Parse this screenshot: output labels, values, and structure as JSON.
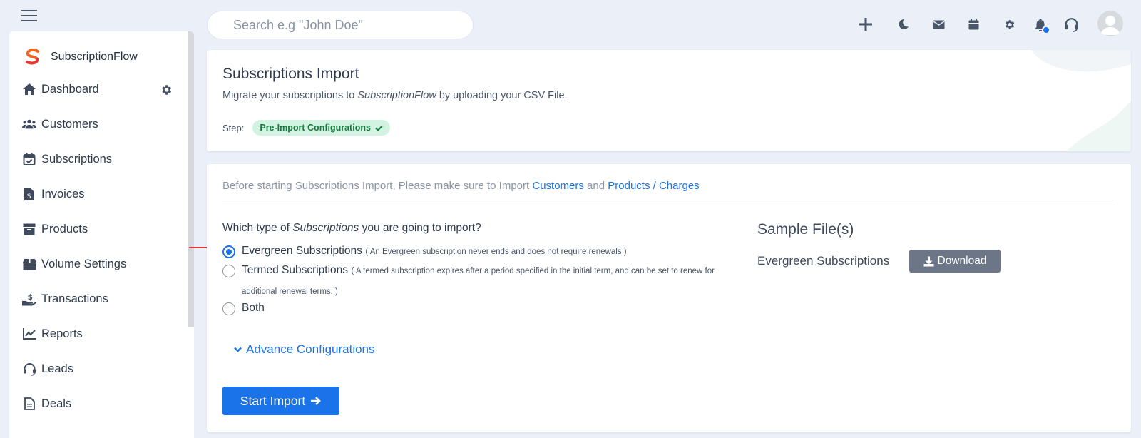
{
  "topbar": {
    "search_placeholder": "Search e.g \"John Doe\"",
    "icons": [
      "plus-icon",
      "moon-icon",
      "envelope-icon",
      "calendar-icon",
      "gear-icon",
      "bell-icon",
      "headset-icon"
    ],
    "notification_color": "#1a73e8"
  },
  "sidebar": {
    "brand": "SubscriptionFlow",
    "items": [
      {
        "label": "Dashboard",
        "icon": "home-icon"
      },
      {
        "label": "Customers",
        "icon": "users-icon"
      },
      {
        "label": "Subscriptions",
        "icon": "calendar-check-icon"
      },
      {
        "label": "Invoices",
        "icon": "invoice-icon"
      },
      {
        "label": "Products",
        "icon": "archive-icon"
      },
      {
        "label": "Volume Settings",
        "icon": "boxes-icon"
      },
      {
        "label": "Transactions",
        "icon": "hand-dollar-icon"
      },
      {
        "label": "Reports",
        "icon": "chart-line-icon"
      },
      {
        "label": "Leads",
        "icon": "headset-icon"
      },
      {
        "label": "Deals",
        "icon": "file-icon"
      }
    ]
  },
  "header": {
    "title": "Subscriptions Import",
    "subtitle_prefix": "Migrate your subscriptions to ",
    "subtitle_brand": "SubscriptionFlow",
    "subtitle_suffix": " by uploading your CSV File.",
    "step_label": "Step:",
    "step_badge": "Pre-Import Configurations"
  },
  "import": {
    "note_prefix": "Before starting Subscriptions Import, Please make sure to Import ",
    "note_link1": "Customers",
    "note_and": " and ",
    "note_link2": "Products / Charges",
    "question_prefix": "Which type of ",
    "question_em": "Subscriptions",
    "question_suffix": " you are going to import?",
    "options": [
      {
        "label": "Evergreen Subscriptions",
        "desc": "( An Evergreen subscription never ends and does not require renewals )",
        "checked": true
      },
      {
        "label": "Termed Subscriptions",
        "desc": "( A termed subscription expires after a period specified in the initial term, and can be set to renew for additional renewal terms. )",
        "checked": false
      },
      {
        "label": "Both",
        "desc": "",
        "checked": false
      }
    ],
    "advance_label": "Advance Configurations",
    "start_button": "Start Import"
  },
  "sample": {
    "title": "Sample File(s)",
    "file_name": "Evergreen Subscriptions",
    "download_label": "Download"
  },
  "colors": {
    "accent": "#1a73e8",
    "badge_bg": "#d3f3e2",
    "badge_text": "#167a3e",
    "download_bg": "#6c7687",
    "arrow": "#e53935"
  }
}
